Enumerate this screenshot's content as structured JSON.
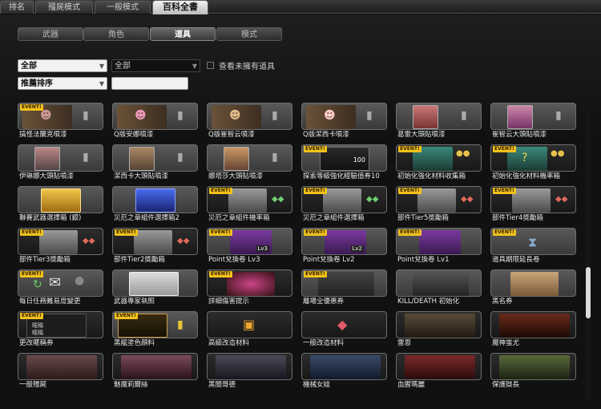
{
  "top_tabs": [
    "排名",
    "殭屍模式",
    "一般模式",
    "百科全書"
  ],
  "sub_tabs": [
    "武器",
    "角色",
    "道具",
    "模式"
  ],
  "filters": {
    "category": "全部",
    "subcategory": "全部",
    "sort": "推薦排序",
    "search_value": "",
    "unowned_label": "查看未擁有道具"
  },
  "event_badge": "EVENT!",
  "items": [
    [
      "搞怪法蘭克噴漆",
      "Q版安娜噴漆",
      "Q版崔智云噴漆",
      "Q版潔西卡噴漆",
      "葛雷大頭貼噴漆",
      "崔智云大頭貼噴漆"
    ],
    [
      "伊琳娜大頭貼噴漆",
      "潔西卡大頭貼噴漆",
      "娜塔莎大頭貼噴漆",
      "探索等級強化經驗值券10",
      "初始化強化材料收集箱",
      "初始化強化材料機率箱"
    ],
    [
      "聯賽武器選擇箱 (銀)",
      "災厄之章組件選擇箱2",
      "災厄之章組件機率箱",
      "災厄之章組件選擇箱",
      "部件Tier5獎勵箱",
      "部件Tier4獎勵箱"
    ],
    [
      "部件Tier3獎勵箱",
      "部件Tier2獎勵箱",
      "Point兌換卷 Lv3",
      "Point兌換卷 Lv2",
      "Point兌換卷 Lv1",
      "道具期限延長卷"
    ],
    [
      "每日任務難易度變更",
      "武器專家執照",
      "詳細傷害提示",
      "離場全優惠券",
      "KILL/DEATH 初始化",
      "黑名券"
    ],
    [
      "更改暱稱券",
      "黑龍塗色顏料",
      "高級改造材料",
      "一般改造材料",
      "雷恩",
      "魔神蚩尤"
    ],
    [
      "一般殭屍",
      "魅魔莉爾絲",
      "黑闇哥德",
      "機械女娃",
      "血腥瑪麗",
      "保護獄長"
    ]
  ],
  "thumb_texts": {
    "exp_ticket": "100",
    "point_lv3": "Lv3",
    "point_lv2": "Lv2",
    "nickname_1": "暱稱",
    "nickname_2": "暱稱"
  },
  "colors": {
    "event_badge": "#f2c21b",
    "background": "#0c0c0c",
    "card": "#4a4a4a"
  }
}
